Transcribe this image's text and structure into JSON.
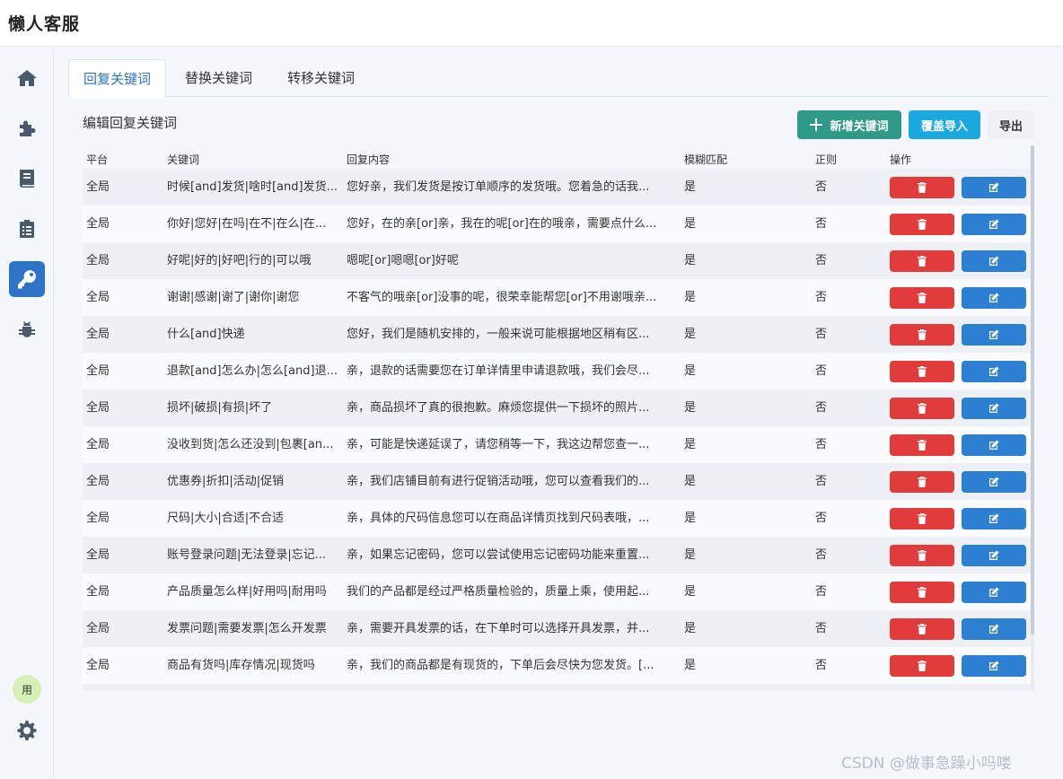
{
  "app": {
    "title": "懒人客服"
  },
  "sidebar": {
    "items": [
      {
        "icon": "home-icon"
      },
      {
        "icon": "puzzle-icon"
      },
      {
        "icon": "book-icon"
      },
      {
        "icon": "clipboard-icon"
      },
      {
        "icon": "key-icon",
        "active": true
      },
      {
        "icon": "bug-icon"
      }
    ],
    "avatar_label": "用",
    "settings_icon": "gear-icon"
  },
  "tabs": [
    {
      "label": "回复关键词",
      "active": true
    },
    {
      "label": "替换关键词",
      "active": false
    },
    {
      "label": "转移关键词",
      "active": false
    }
  ],
  "main": {
    "section_title": "编辑回复关键词",
    "buttons": {
      "add": "新增关键词",
      "import": "覆盖导入",
      "export": "导出"
    }
  },
  "table": {
    "headers": {
      "platform": "平台",
      "keyword": "关键词",
      "reply": "回复内容",
      "fuzzy": "模糊匹配",
      "regex": "正则",
      "actions": "操作"
    },
    "rows": [
      {
        "platform": "全局",
        "keyword": "时候[and]发货|啥时[and]发货...",
        "reply": "您好亲，我们发货是按订单顺序的发货哦。您着急的话我...",
        "fuzzy": "是",
        "regex": "否"
      },
      {
        "platform": "全局",
        "keyword": "你好|您好|在吗|在不|在么|在...",
        "reply": "您好，在的亲[or]亲，我在的呢[or]在的哦亲，需要点什么...",
        "fuzzy": "是",
        "regex": "否"
      },
      {
        "platform": "全局",
        "keyword": "好呢|好的|好吧|行的|可以哦",
        "reply": "嗯呢[or]嗯嗯[or]好呢",
        "fuzzy": "是",
        "regex": "否"
      },
      {
        "platform": "全局",
        "keyword": "谢谢|感谢|谢了|谢你|谢您",
        "reply": "不客气的哦亲[or]没事的呢，很荣幸能帮您[or]不用谢哦亲...",
        "fuzzy": "是",
        "regex": "否"
      },
      {
        "platform": "全局",
        "keyword": "什么[and]快递",
        "reply": "您好，我们是随机安排的，一般来说可能根据地区稍有区...",
        "fuzzy": "是",
        "regex": "否"
      },
      {
        "platform": "全局",
        "keyword": "退款[and]怎么办|怎么[and]退...",
        "reply": "亲，退款的话需要您在订单详情里申请退款哦，我们会尽...",
        "fuzzy": "是",
        "regex": "否"
      },
      {
        "platform": "全局",
        "keyword": "损坏|破损|有损|坏了",
        "reply": "亲，商品损坏了真的很抱歉。麻烦您提供一下损坏的照片...",
        "fuzzy": "是",
        "regex": "否"
      },
      {
        "platform": "全局",
        "keyword": "没收到货|怎么还没到|包裹[an...",
        "reply": "亲，可能是快递延误了，请您稍等一下，我这边帮您查一...",
        "fuzzy": "是",
        "regex": "否"
      },
      {
        "platform": "全局",
        "keyword": "优惠券|折扣|活动|促销",
        "reply": "亲，我们店铺目前有进行促销活动哦，您可以查看我们的...",
        "fuzzy": "是",
        "regex": "否"
      },
      {
        "platform": "全局",
        "keyword": "尺码|大小|合适|不合适",
        "reply": "亲，具体的尺码信息您可以在商品详情页找到尺码表哦，...",
        "fuzzy": "是",
        "regex": "否"
      },
      {
        "platform": "全局",
        "keyword": "账号登录问题|无法登录|忘记...",
        "reply": "亲，如果忘记密码，您可以尝试使用忘记密码功能来重置...",
        "fuzzy": "是",
        "regex": "否"
      },
      {
        "platform": "全局",
        "keyword": "产品质量怎么样|好用吗|耐用吗",
        "reply": "我们的产品都是经过严格质量检验的，质量上乘，使用起...",
        "fuzzy": "是",
        "regex": "否"
      },
      {
        "platform": "全局",
        "keyword": "发票问题|需要发票|怎么开发票",
        "reply": "亲，需要开具发票的话，在下单时可以选择开具发票，并...",
        "fuzzy": "是",
        "regex": "否"
      },
      {
        "platform": "全局",
        "keyword": "商品有货吗|库存情况|现货吗",
        "reply": "亲，我们的商品都是有现货的，下单后会尽快为您发货。[...",
        "fuzzy": "是",
        "regex": "否"
      },
      {
        "platform": "",
        "keyword": "",
        "reply": "",
        "fuzzy": "",
        "regex": ""
      }
    ]
  },
  "watermark": "CSDN @做事急躁小吗喽"
}
